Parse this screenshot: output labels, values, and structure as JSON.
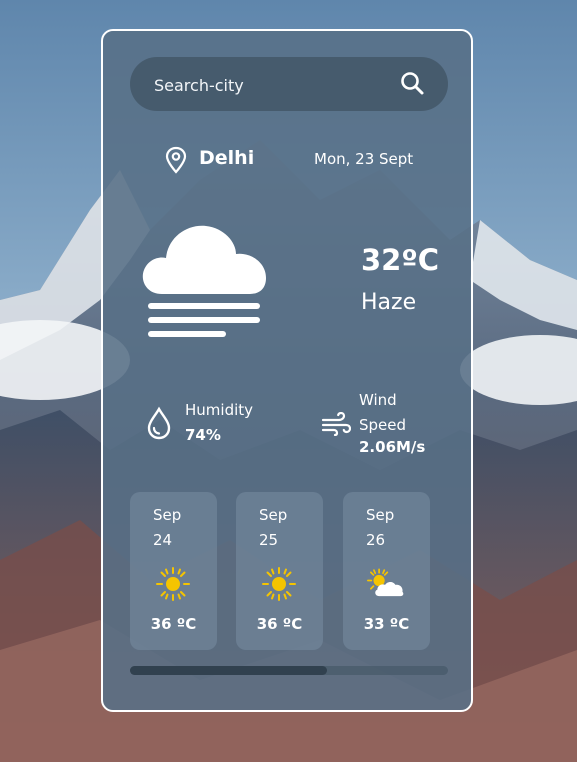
{
  "search": {
    "placeholder": "Search-city"
  },
  "location": {
    "city": "Delhi",
    "date": "Mon, 23 Sept"
  },
  "current": {
    "temperature": "32ºC",
    "condition": "Haze",
    "icon": "haze-cloud-icon"
  },
  "humidity": {
    "label": "Humidity",
    "value": "74%",
    "icon": "water-drop-icon"
  },
  "wind": {
    "label": "Wind Speed",
    "value": "2.06M/s",
    "icon": "wind-icon"
  },
  "forecast": [
    {
      "month": "Sep",
      "day": "24",
      "temp": "36 ºC",
      "icon": "sun-icon"
    },
    {
      "month": "Sep",
      "day": "25",
      "temp": "36 ºC",
      "icon": "sun-icon"
    },
    {
      "month": "Sep",
      "day": "26",
      "temp": "33 ºC",
      "icon": "partly-cloudy-icon"
    }
  ],
  "scroll": {
    "position_fraction": 0.62
  },
  "colors": {
    "sun": "#f5c400",
    "card_border": "#ffffff",
    "text": "#ffffff"
  }
}
